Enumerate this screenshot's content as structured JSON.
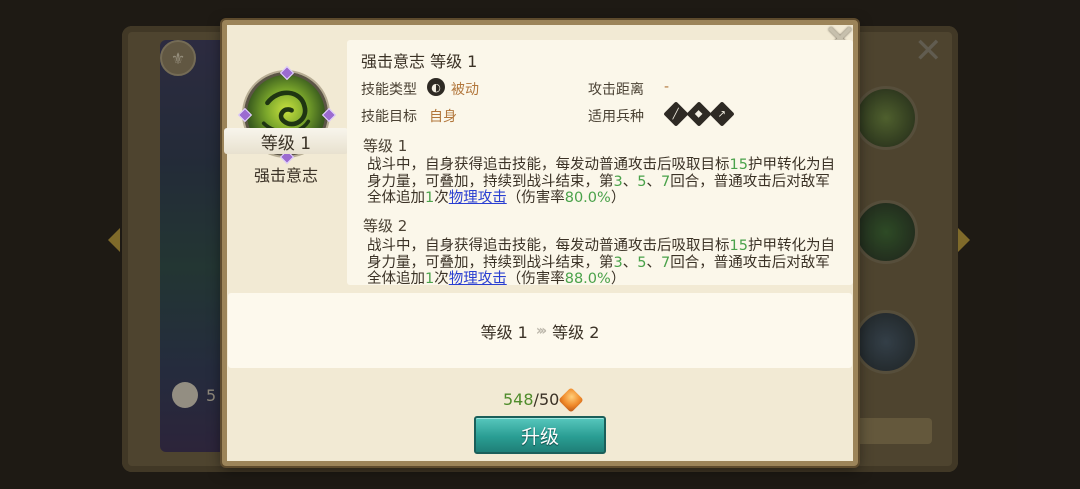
{
  "popup": {
    "skill_name": "强击意志",
    "level_ribbon": "等级 1",
    "title": "强击意志 等级 1",
    "labels": {
      "skill_type": "技能类型",
      "skill_target": "技能目标",
      "attack_range": "攻击距离",
      "troop_type": "适用兵种"
    },
    "values": {
      "skill_type": "被动",
      "skill_target": "自身",
      "attack_range": "-"
    },
    "levels": [
      {
        "head": "等级 1",
        "desc_parts": [
          {
            "t": "战斗中，自身获得追击技能，每发动普通攻击后吸取目标",
            "c": ""
          },
          {
            "t": "15",
            "c": "g"
          },
          {
            "t": "护甲转化为自身力量，可叠加，持续到战斗结束，第",
            "c": ""
          },
          {
            "t": "3",
            "c": "g"
          },
          {
            "t": "、",
            "c": ""
          },
          {
            "t": "5",
            "c": "g"
          },
          {
            "t": "、",
            "c": ""
          },
          {
            "t": "7",
            "c": "g"
          },
          {
            "t": "回合，普通攻击后对敌军全体追加",
            "c": ""
          },
          {
            "t": "1",
            "c": "g"
          },
          {
            "t": "次",
            "c": ""
          },
          {
            "t": "物理攻击",
            "c": "link"
          },
          {
            "t": "（伤害率",
            "c": ""
          },
          {
            "t": "80.0%",
            "c": "g"
          },
          {
            "t": "）",
            "c": ""
          }
        ]
      },
      {
        "head": "等级 2",
        "desc_parts": [
          {
            "t": "战斗中，自身获得追击技能，每发动普通攻击后吸取目标",
            "c": ""
          },
          {
            "t": "15",
            "c": "g"
          },
          {
            "t": "护甲转化为自身力量，可叠加，持续到战斗结束，第",
            "c": ""
          },
          {
            "t": "3",
            "c": "g"
          },
          {
            "t": "、",
            "c": ""
          },
          {
            "t": "5",
            "c": "g"
          },
          {
            "t": "、",
            "c": ""
          },
          {
            "t": "7",
            "c": "g"
          },
          {
            "t": "回合，普通攻击后对敌军全体追加",
            "c": ""
          },
          {
            "t": "1",
            "c": "g"
          },
          {
            "t": "次",
            "c": ""
          },
          {
            "t": "物理攻击",
            "c": "link"
          },
          {
            "t": "（伤害率",
            "c": ""
          },
          {
            "t": "88.0%",
            "c": "g"
          },
          {
            "t": "）",
            "c": ""
          }
        ]
      }
    ],
    "upgrade_from": "等级 1",
    "upgrade_to": "等级 2",
    "cost_have": "548",
    "cost_need": "/50",
    "upgrade_button": "升级"
  },
  "icons": {
    "close": "close-icon",
    "skill": "skill-swirl-icon",
    "passive": "passive-skill-icon",
    "troops": [
      "infantry-icon",
      "cavalry-icon",
      "archer-icon"
    ],
    "cost": "orange-gem-icon"
  },
  "colors": {
    "highlight_green": "#4aa24a",
    "link_blue": "#2a3fd1",
    "value_orange": "#b2773c",
    "button_teal": "#2a9d93"
  }
}
